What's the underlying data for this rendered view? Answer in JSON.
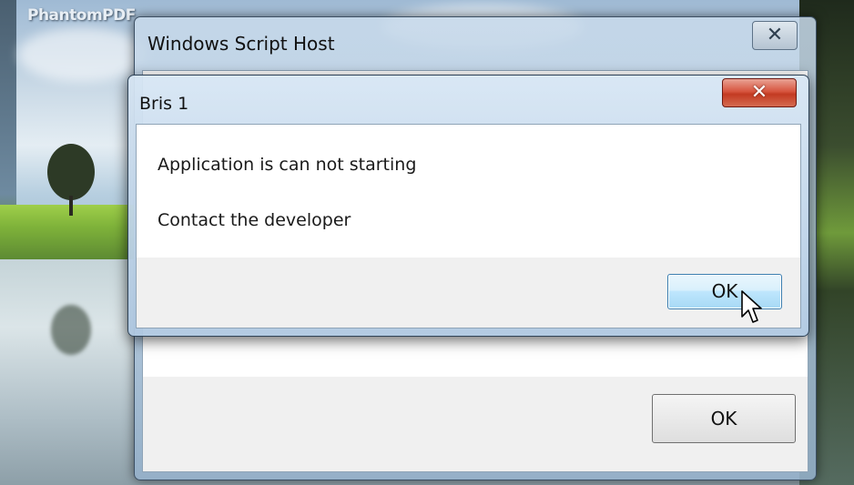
{
  "watermark": "PhantomPDF",
  "back_dialog": {
    "title": "Windows Script Host",
    "close_label": "✕",
    "ok_label": "OK"
  },
  "front_dialog": {
    "title": "Bris 1",
    "close_label": "✕",
    "messages": [
      "Application is can not starting",
      "Contact the developer"
    ],
    "ok_label": "OK"
  },
  "icons": {
    "cursor": "arrow-cursor-icon"
  }
}
